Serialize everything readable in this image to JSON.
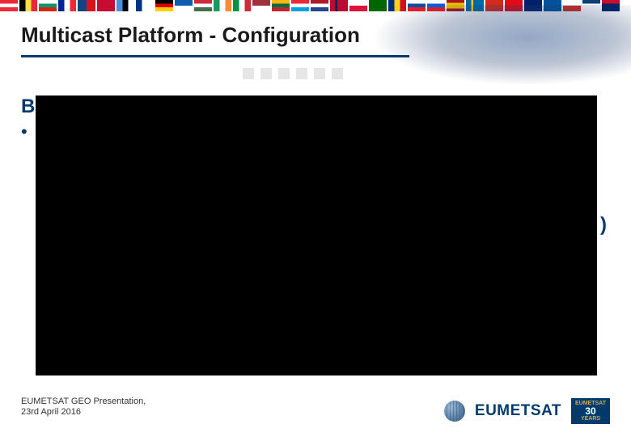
{
  "title": "Multicast Platform - Configuration",
  "body_fragment_left": "B",
  "bullet": "•",
  "body_fragment_right": ")",
  "footer": {
    "line1": "EUMETSAT GEO Presentation,",
    "line2": "23rd April 2016"
  },
  "logo": {
    "text": "EUMETSAT",
    "badge_top": "EUMETSAT",
    "badge_num": "30",
    "badge_bottom": "YEARS"
  },
  "flags_count": 32,
  "squares_count": 6
}
